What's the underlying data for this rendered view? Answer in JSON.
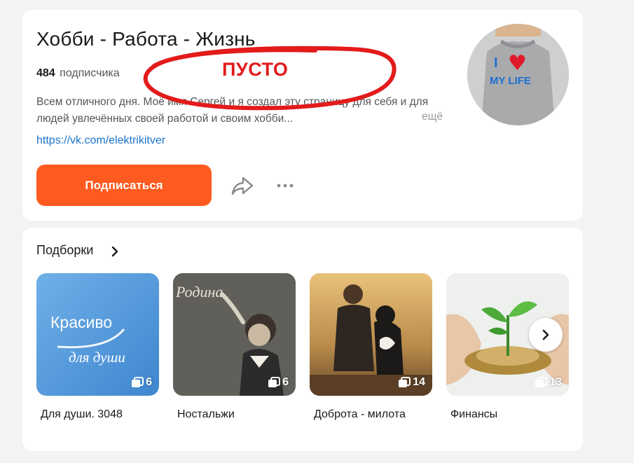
{
  "profile": {
    "title": "Хобби - Работа - Жизнь",
    "subscribers_count": "484",
    "subscribers_label": "подписчика",
    "description": "Всем отличного дня. Моё имя Сергей и я создал эту страницу для себя и для людей увлечённых своей работой и своим хобби...",
    "more_label": "ещё",
    "link": "https://vk.com/elektrikitver",
    "subscribe_label": "Подписаться",
    "avatar": {
      "line1": "I",
      "line2": "MY LIFE",
      "heart": "♥"
    }
  },
  "annotation": {
    "text": "ПУСТО",
    "color": "#e31b1b"
  },
  "collections": {
    "title": "Подборки",
    "items": [
      {
        "name": "Для души. 3048",
        "count": "6",
        "image_text_1": "Красиво",
        "image_text_2": "для души"
      },
      {
        "name": "Ностальжи",
        "count": "6",
        "image_text_1": "Родина"
      },
      {
        "name": "Доброта - милота",
        "count": "14"
      },
      {
        "name": "Финансы",
        "count": "13"
      }
    ]
  },
  "colors": {
    "accent": "#ff5a1f",
    "link": "#1a73c8",
    "background": "#f2f3f5"
  },
  "icons": [
    "share-icon",
    "more-dots-icon",
    "chevron-right-icon",
    "stack-icon",
    "arrow-right-icon"
  ]
}
